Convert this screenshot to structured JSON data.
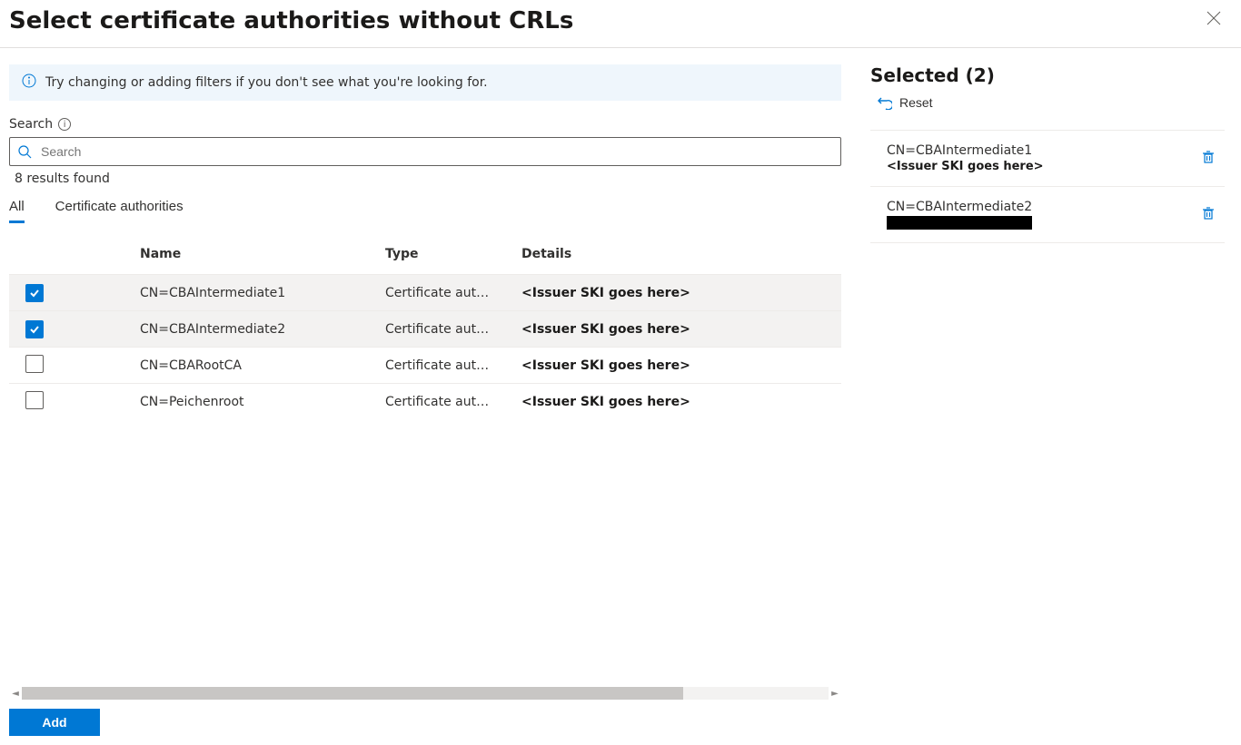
{
  "header": {
    "title": "Select certificate authorities without CRLs"
  },
  "info_banner": {
    "text": "Try changing or adding filters if you don't see what you're looking for."
  },
  "search": {
    "label": "Search",
    "placeholder": "Search",
    "results_text": "8 results found"
  },
  "tabs": {
    "all": "All",
    "ca": "Certificate authorities",
    "active": "all"
  },
  "columns": {
    "name": "Name",
    "type": "Type",
    "details": "Details"
  },
  "rows": [
    {
      "checked": true,
      "name": "CN=CBAIntermediate1",
      "type": "Certificate aut…",
      "details": "<Issuer SKI goes here>"
    },
    {
      "checked": true,
      "name": "CN=CBAIntermediate2",
      "type": "Certificate aut…",
      "details": "<Issuer SKI goes here>"
    },
    {
      "checked": false,
      "name": "CN=CBARootCA",
      "type": "Certificate aut…",
      "details": "<Issuer SKI goes here>"
    },
    {
      "checked": false,
      "name": "CN=Peichenroot",
      "type": "Certificate aut…",
      "details": "<Issuer SKI goes here>"
    }
  ],
  "selected": {
    "heading": "Selected (2)",
    "reset_label": "Reset",
    "items": [
      {
        "name": "CN=CBAIntermediate1",
        "detail": "<Issuer SKI goes here>",
        "redacted": false
      },
      {
        "name": "CN=CBAIntermediate2",
        "detail": "redacted",
        "redacted": true
      }
    ]
  },
  "footer": {
    "add_label": "Add"
  }
}
